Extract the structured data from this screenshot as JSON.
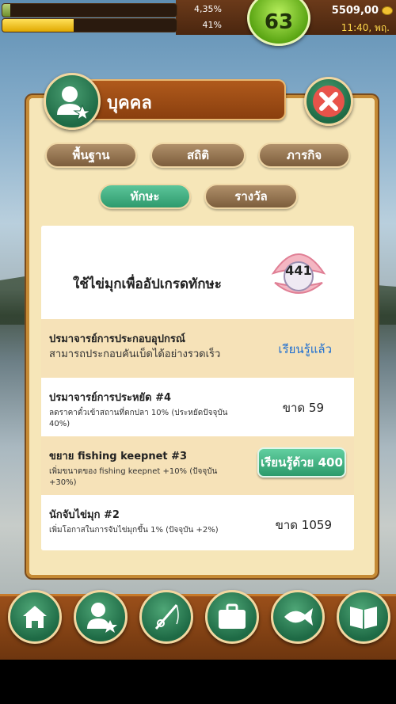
{
  "hud": {
    "progress_1_label": "4,35%",
    "progress_1_value": 0.0435,
    "progress_2_label": "41%",
    "progress_2_value": 0.41,
    "level": "63",
    "coins": "5509,00",
    "time": "11:40, พฤ."
  },
  "dialog": {
    "title": "บุคคล",
    "tabs": [
      "พื้นฐาน",
      "สถิติ",
      "ภารกิจ",
      "ทักษะ",
      "รางวัล"
    ],
    "active_tab": "ทักษะ"
  },
  "skills": {
    "header_text": "ใช้ไข่มุกเพื่ออัปเกรดทักษะ",
    "pearls": "441",
    "rows": [
      {
        "name": "ปรมาจารย์การประกอบอุปกรณ์",
        "desc": "สามารถประกอบคันเบ็ดได้อย่างรวดเร็ว",
        "status": "เรียนรู้แล้ว"
      },
      {
        "name": "ปรมาจารย์การประหยัด #4",
        "desc": "ลดราคาตั๋วเข้าสถานที่ตกปลา 10% (ประหยัดปัจจุบัน 40%)",
        "status": "ขาด 59"
      },
      {
        "name": "ขยาย fishing keepnet #3",
        "desc": "เพิ่มขนาดของ fishing keepnet +10% (ปัจจุบัน +30%)",
        "button": "เรียนรู้ด้วย 400"
      },
      {
        "name": "นักจับไข่มุก #2",
        "desc": "เพิ่มโอกาสในการจับไข่มุกขึ้น 1% (ปัจจุบัน +2%)",
        "status": "ขาด 1059"
      }
    ]
  },
  "icons": {
    "avatar": "user-star-icon",
    "close": "close-x-icon",
    "nav": [
      "home-icon",
      "user-star-icon",
      "fishing-rod-icon",
      "briefcase-icon",
      "fish-icon",
      "book-icon"
    ]
  },
  "colors": {
    "panel_bg": "#f6e6b8",
    "accent_green": "#2e9a6d",
    "learned_blue": "#1f6fd1",
    "wood": "#8a3f0e"
  }
}
